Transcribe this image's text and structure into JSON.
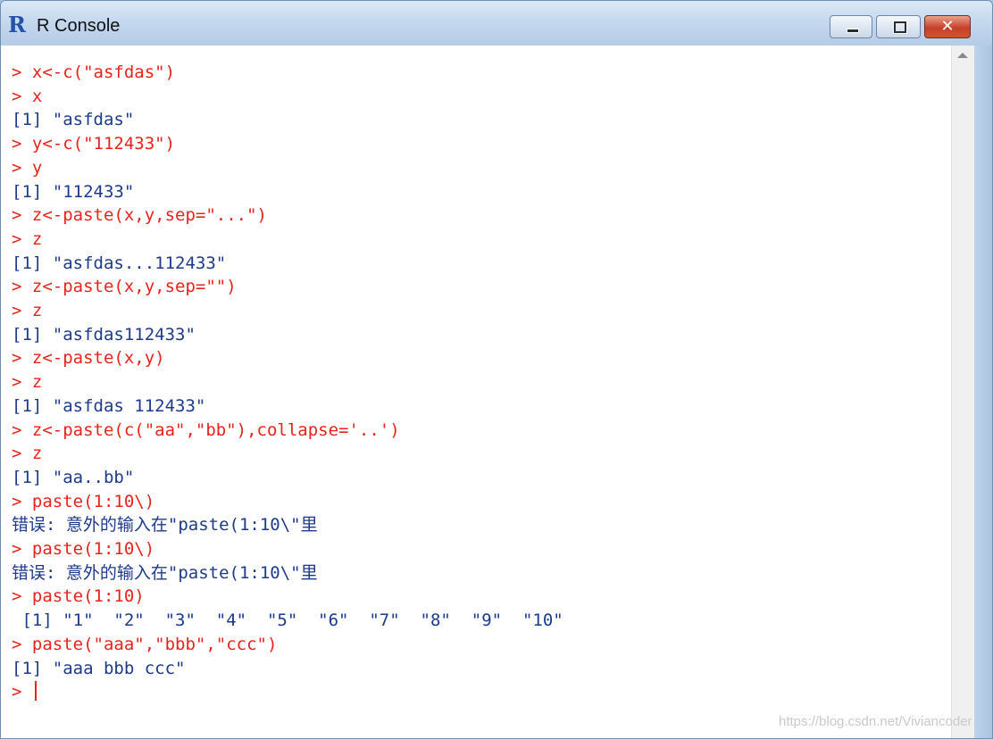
{
  "window": {
    "title": "R Console",
    "icon_letter": "R",
    "close_glyph": "✕"
  },
  "lines": [
    {
      "type": "cmd",
      "text": "> x<-c(\"asfdas\")"
    },
    {
      "type": "cmd",
      "text": "> x"
    },
    {
      "type": "out",
      "text": "[1] \"asfdas\""
    },
    {
      "type": "cmd",
      "text": "> y<-c(\"112433\")"
    },
    {
      "type": "cmd",
      "text": "> y"
    },
    {
      "type": "out",
      "text": "[1] \"112433\""
    },
    {
      "type": "cmd",
      "text": "> z<-paste(x,y,sep=\"...\")"
    },
    {
      "type": "cmd",
      "text": "> z"
    },
    {
      "type": "out",
      "text": "[1] \"asfdas...112433\""
    },
    {
      "type": "cmd",
      "text": "> z<-paste(x,y,sep=\"\")"
    },
    {
      "type": "cmd",
      "text": "> z"
    },
    {
      "type": "out",
      "text": "[1] \"asfdas112433\""
    },
    {
      "type": "cmd",
      "text": "> z<-paste(x,y)"
    },
    {
      "type": "cmd",
      "text": "> z"
    },
    {
      "type": "out",
      "text": "[1] \"asfdas 112433\""
    },
    {
      "type": "cmd",
      "text": "> z<-paste(c(\"aa\",\"bb\"),collapse='..')"
    },
    {
      "type": "cmd",
      "text": "> z"
    },
    {
      "type": "out",
      "text": "[1] \"aa..bb\""
    },
    {
      "type": "cmd",
      "text": "> paste(1:10\\)"
    },
    {
      "type": "err",
      "text": "错误: 意外的输入在\"paste(1:10\\\"里"
    },
    {
      "type": "cmd",
      "text": "> paste(1:10\\)"
    },
    {
      "type": "err",
      "text": "错误: 意外的输入在\"paste(1:10\\\"里"
    },
    {
      "type": "cmd",
      "text": "> paste(1:10)"
    },
    {
      "type": "out",
      "text": " [1] \"1\"  \"2\"  \"3\"  \"4\"  \"5\"  \"6\"  \"7\"  \"8\"  \"9\"  \"10\""
    },
    {
      "type": "cmd",
      "text": "> paste(\"aaa\",\"bbb\",\"ccc\")"
    },
    {
      "type": "out",
      "text": "[1] \"aaa bbb ccc\""
    },
    {
      "type": "cmd",
      "text": "> "
    }
  ],
  "watermark": "https://blog.csdn.net/Viviancoder"
}
